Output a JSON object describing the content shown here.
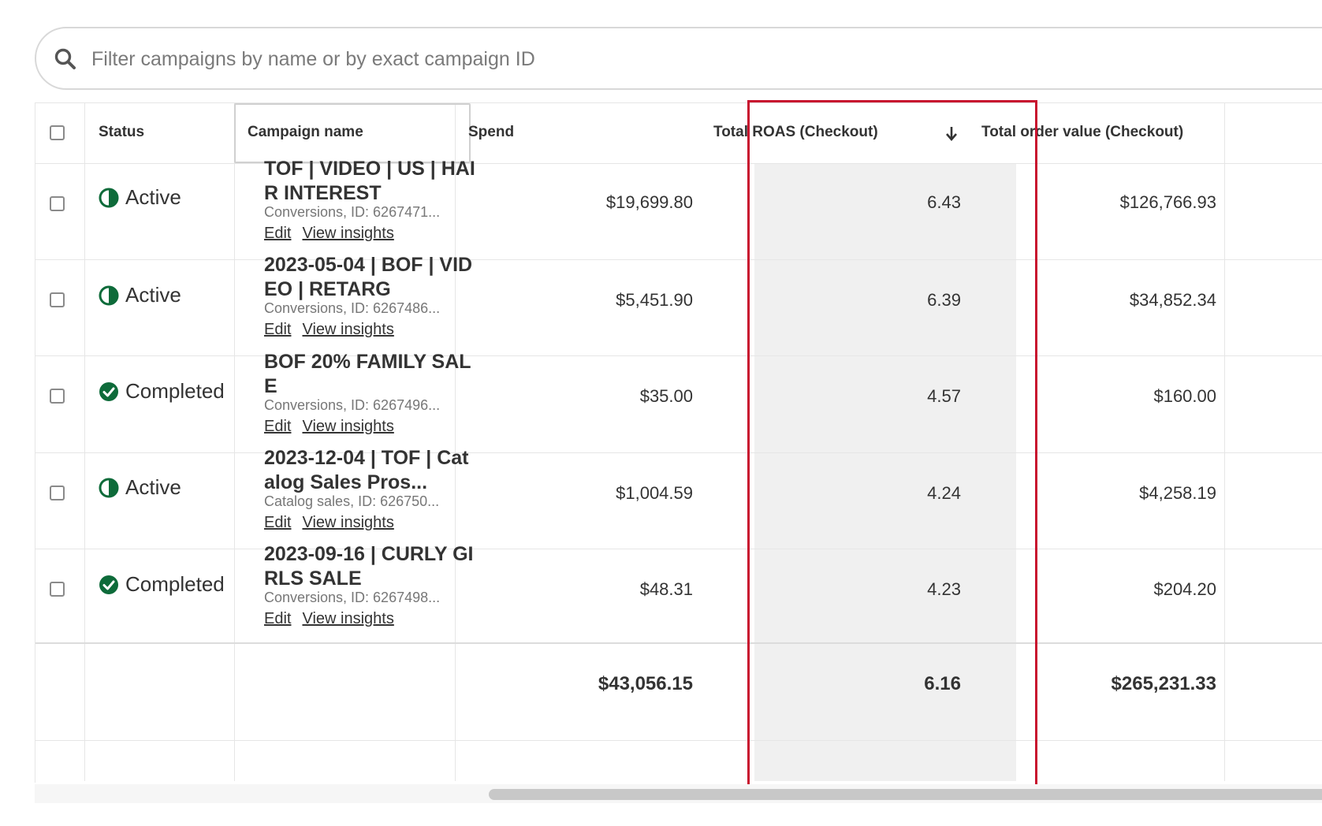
{
  "search": {
    "placeholder": "Filter campaigns by name or by exact campaign ID"
  },
  "table": {
    "headers": {
      "status": "Status",
      "campaign_name": "Campaign name",
      "spend": "Spend",
      "total_roas": "Total ROAS (Checkout)",
      "total_order_value": "Total order value (Checkout)"
    },
    "sorted_column": "Total ROAS (Checkout)",
    "sort_direction": "descending",
    "rows": [
      {
        "status": "Active",
        "status_icon": "half-circle-icon",
        "name": "TOF | VIDEO | US | HAIR INTEREST",
        "sub": "Conversions, ID: 6267471...",
        "edit": "Edit",
        "insights": "View insights",
        "spend": "$19,699.80",
        "roas": "6.43",
        "order_value": "$126,766.93"
      },
      {
        "status": "Active",
        "status_icon": "half-circle-icon",
        "name": "2023-05-04 | BOF | VIDEO | RETARG",
        "sub": "Conversions, ID: 6267486...",
        "edit": "Edit",
        "insights": "View insights",
        "spend": "$5,451.90",
        "roas": "6.39",
        "order_value": "$34,852.34"
      },
      {
        "status": "Completed",
        "status_icon": "check-circle-icon",
        "name": "BOF 20% FAMILY SALE",
        "sub": "Conversions, ID: 6267496...",
        "edit": "Edit",
        "insights": "View insights",
        "spend": "$35.00",
        "roas": "4.57",
        "order_value": "$160.00"
      },
      {
        "status": "Active",
        "status_icon": "half-circle-icon",
        "name": "2023-12-04 | TOF | Catalog Sales Pros...",
        "sub": "Catalog sales, ID: 626750...",
        "edit": "Edit",
        "insights": "View insights",
        "spend": "$1,004.59",
        "roas": "4.24",
        "order_value": "$4,258.19"
      },
      {
        "status": "Completed",
        "status_icon": "check-circle-icon",
        "name": "2023-09-16 | CURLY GIRLS SALE",
        "sub": "Conversions, ID: 6267498...",
        "edit": "Edit",
        "insights": "View insights",
        "spend": "$48.31",
        "roas": "4.23",
        "order_value": "$204.20"
      }
    ],
    "totals": {
      "spend": "$43,056.15",
      "roas": "6.16",
      "order_value": "$265,231.33"
    }
  },
  "colors": {
    "status_green": "#0e6b3a",
    "highlight_red": "#c8102e",
    "sorted_column_bg": "#f0f0f0"
  }
}
